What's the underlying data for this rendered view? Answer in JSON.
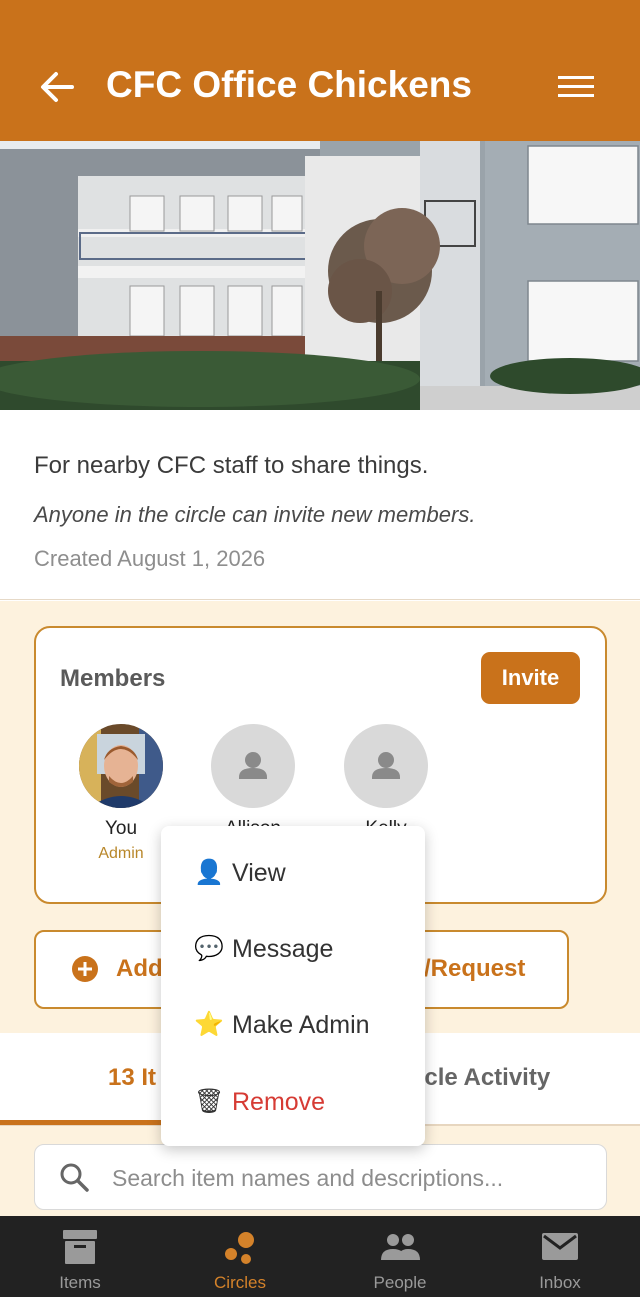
{
  "header": {
    "title": "CFC Office Chickens",
    "back_icon": "arrow-left-icon",
    "menu_icon": "hamburger-menu-icon"
  },
  "circle": {
    "description": "For nearby CFC staff to share things.",
    "invite_policy": "Anyone in the circle can invite new members.",
    "created": "Created August 1, 2026"
  },
  "members": {
    "title": "Members",
    "invite_label": "Invite",
    "list": [
      {
        "name": "You",
        "role": "Admin"
      },
      {
        "name": "Allison",
        "role": ""
      },
      {
        "name": "Kelly",
        "role": ""
      }
    ]
  },
  "add_button": {
    "label_left": "Add",
    "label_right": "/Request"
  },
  "tabs": {
    "left": "13 It",
    "right": "rcle Activity"
  },
  "search": {
    "placeholder": "Search item names and descriptions..."
  },
  "bottom_nav": [
    {
      "label": "Items",
      "icon": "archive-box-icon"
    },
    {
      "label": "Circles",
      "icon": "circles-icon"
    },
    {
      "label": "People",
      "icon": "people-icon"
    },
    {
      "label": "Inbox",
      "icon": "mail-icon"
    }
  ],
  "context_menu": [
    {
      "label": "View",
      "icon": "person-silhouette-icon"
    },
    {
      "label": "Message",
      "icon": "speech-bubble-icon"
    },
    {
      "label": "Make Admin",
      "icon": "star-icon"
    },
    {
      "label": "Remove",
      "icon": "trash-can-icon"
    }
  ],
  "colors": {
    "brand": "#c9721b",
    "cream": "#fdf2de",
    "danger": "#d63b34"
  }
}
